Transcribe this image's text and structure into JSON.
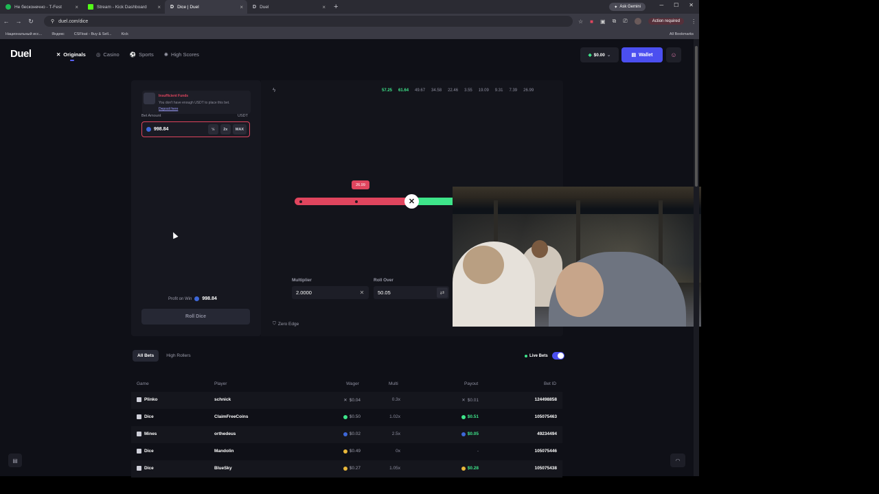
{
  "browser": {
    "tabs": [
      {
        "title": "Не бесконечно - T-Fest",
        "color": "#1db954"
      },
      {
        "title": "Stream - Kick Dashboard",
        "color": "#53fc18"
      },
      {
        "title": "Dice | Duel",
        "color": "#888888"
      },
      {
        "title": "Duel",
        "color": "#888888"
      }
    ],
    "new_tab": "+",
    "gemini_label": "Ask Gemini",
    "url": "duel.com/dice",
    "action_required": "Action required",
    "bookmarks": [
      "Национальный исс...",
      "Яндекс",
      "CSFloat - Buy & Sell...",
      "Kick"
    ],
    "all_bookmarks": "All Bookmarks"
  },
  "site": {
    "logo": "Duel",
    "nav": [
      {
        "label": "Originals",
        "icon": "x-icon",
        "active": true
      },
      {
        "label": "Casino",
        "icon": "casino-icon"
      },
      {
        "label": "Sports",
        "icon": "sports-icon"
      },
      {
        "label": "High Scores",
        "icon": "trophy-icon"
      }
    ],
    "balance": "$0.00",
    "wallet_label": "Wallet"
  },
  "game": {
    "toast_title": "Insufficient Funds",
    "toast_message": "You don't have enough USDT to place this bet.",
    "toast_link": "Deposit here",
    "bet_label": "Bet Amount",
    "bet_currency": "USDT",
    "bet_amount": "998.84",
    "half_btn": "½",
    "double_btn": "2x",
    "max_btn": "MAX",
    "profit_label": "Profit on Win",
    "profit_value": "998.84",
    "roll_btn": "Roll Dice",
    "history": [
      {
        "value": "57.25",
        "win": true
      },
      {
        "value": "61.64",
        "win": true
      },
      {
        "value": "49.67",
        "win": false
      },
      {
        "value": "34.58",
        "win": false
      },
      {
        "value": "22.46",
        "win": false
      },
      {
        "value": "3.55",
        "win": false
      },
      {
        "value": "19.09",
        "win": false
      },
      {
        "value": "9.31",
        "win": false
      },
      {
        "value": "7.39",
        "win": false
      },
      {
        "value": "26.99",
        "win": false
      }
    ],
    "slider_tag": "26.99",
    "multiplier_label": "Multiplier",
    "multiplier_value": "2.0000",
    "roll_over_label": "Roll Over",
    "roll_over_value": "50.05",
    "zero_edge": "Zero Edge"
  },
  "bets": {
    "tabs": [
      "All Bets",
      "High Rollers"
    ],
    "live_label": "Live Bets",
    "headers": {
      "game": "Game",
      "player": "Player",
      "wager": "Wager",
      "multi": "Multi",
      "payout": "Payout",
      "bet_id": "Bet ID"
    },
    "rows": [
      {
        "game": "Plinko",
        "player": "schnick",
        "wager": "$0.04",
        "multi": "0.3x",
        "payout": "$0.01",
        "win": false,
        "id": "124498858"
      },
      {
        "game": "Dice",
        "player": "ClaimFreeCoins",
        "wager": "$0.50",
        "multi": "1.02x",
        "payout": "$0.51",
        "win": true,
        "id": "105075463"
      },
      {
        "game": "Mines",
        "player": "orthedeus",
        "wager": "$0.02",
        "multi": "2.5x",
        "payout": "$0.05",
        "win": true,
        "id": "49234494"
      },
      {
        "game": "Dice",
        "player": "Mandolin",
        "wager": "$0.49",
        "multi": "0x",
        "payout": "-",
        "win": false,
        "id": "105075446"
      },
      {
        "game": "Dice",
        "player": "BlueSky",
        "wager": "$0.27",
        "multi": "1.05x",
        "payout": "$0.28",
        "win": true,
        "id": "105075438"
      }
    ]
  },
  "colors": {
    "accent": "#4b4ff0",
    "win": "#3ee58a",
    "lose": "#e0455e"
  }
}
